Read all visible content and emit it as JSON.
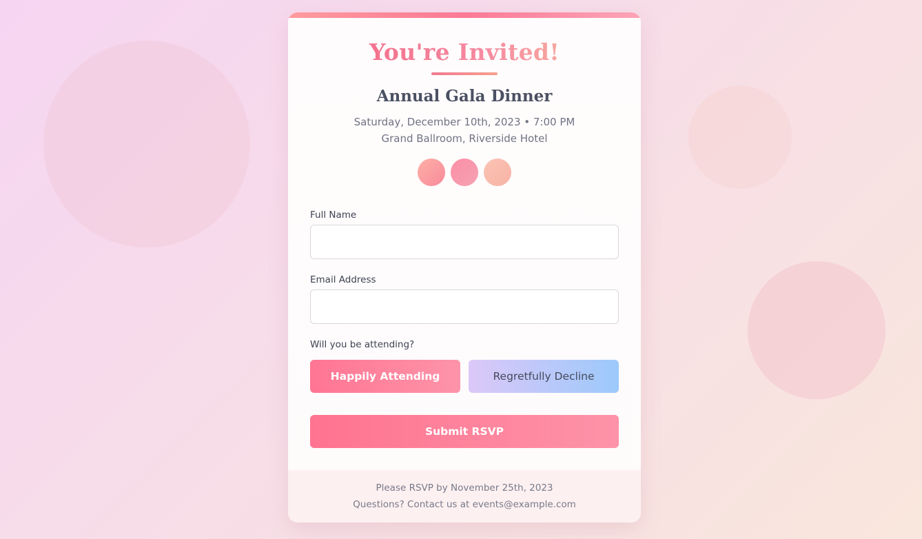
{
  "invitation": {
    "title": "You're Invited!",
    "event_name": "Annual Gala Dinner",
    "date_time": "Saturday, December 10th, 2023 • 7:00 PM",
    "venue": "Grand Ballroom, Riverside Hotel"
  },
  "form": {
    "full_name_label": "Full Name",
    "full_name_value": "",
    "email_label": "Email Address",
    "email_value": "",
    "attending_question": "Will you be attending?",
    "attending_button": "Happily Attending",
    "decline_button": "Regretfully Decline",
    "submit_button": "Submit RSVP"
  },
  "footer": {
    "rsvp_deadline": "Please RSVP by November 25th, 2023",
    "contact": "Questions? Contact us at events@example.com"
  },
  "colors": {
    "accent_pink": "#ff7593",
    "decline_gradient_start": "#dcc8f8",
    "decline_gradient_end": "#9cc9fb",
    "footer_bg": "#fdf0f1"
  }
}
